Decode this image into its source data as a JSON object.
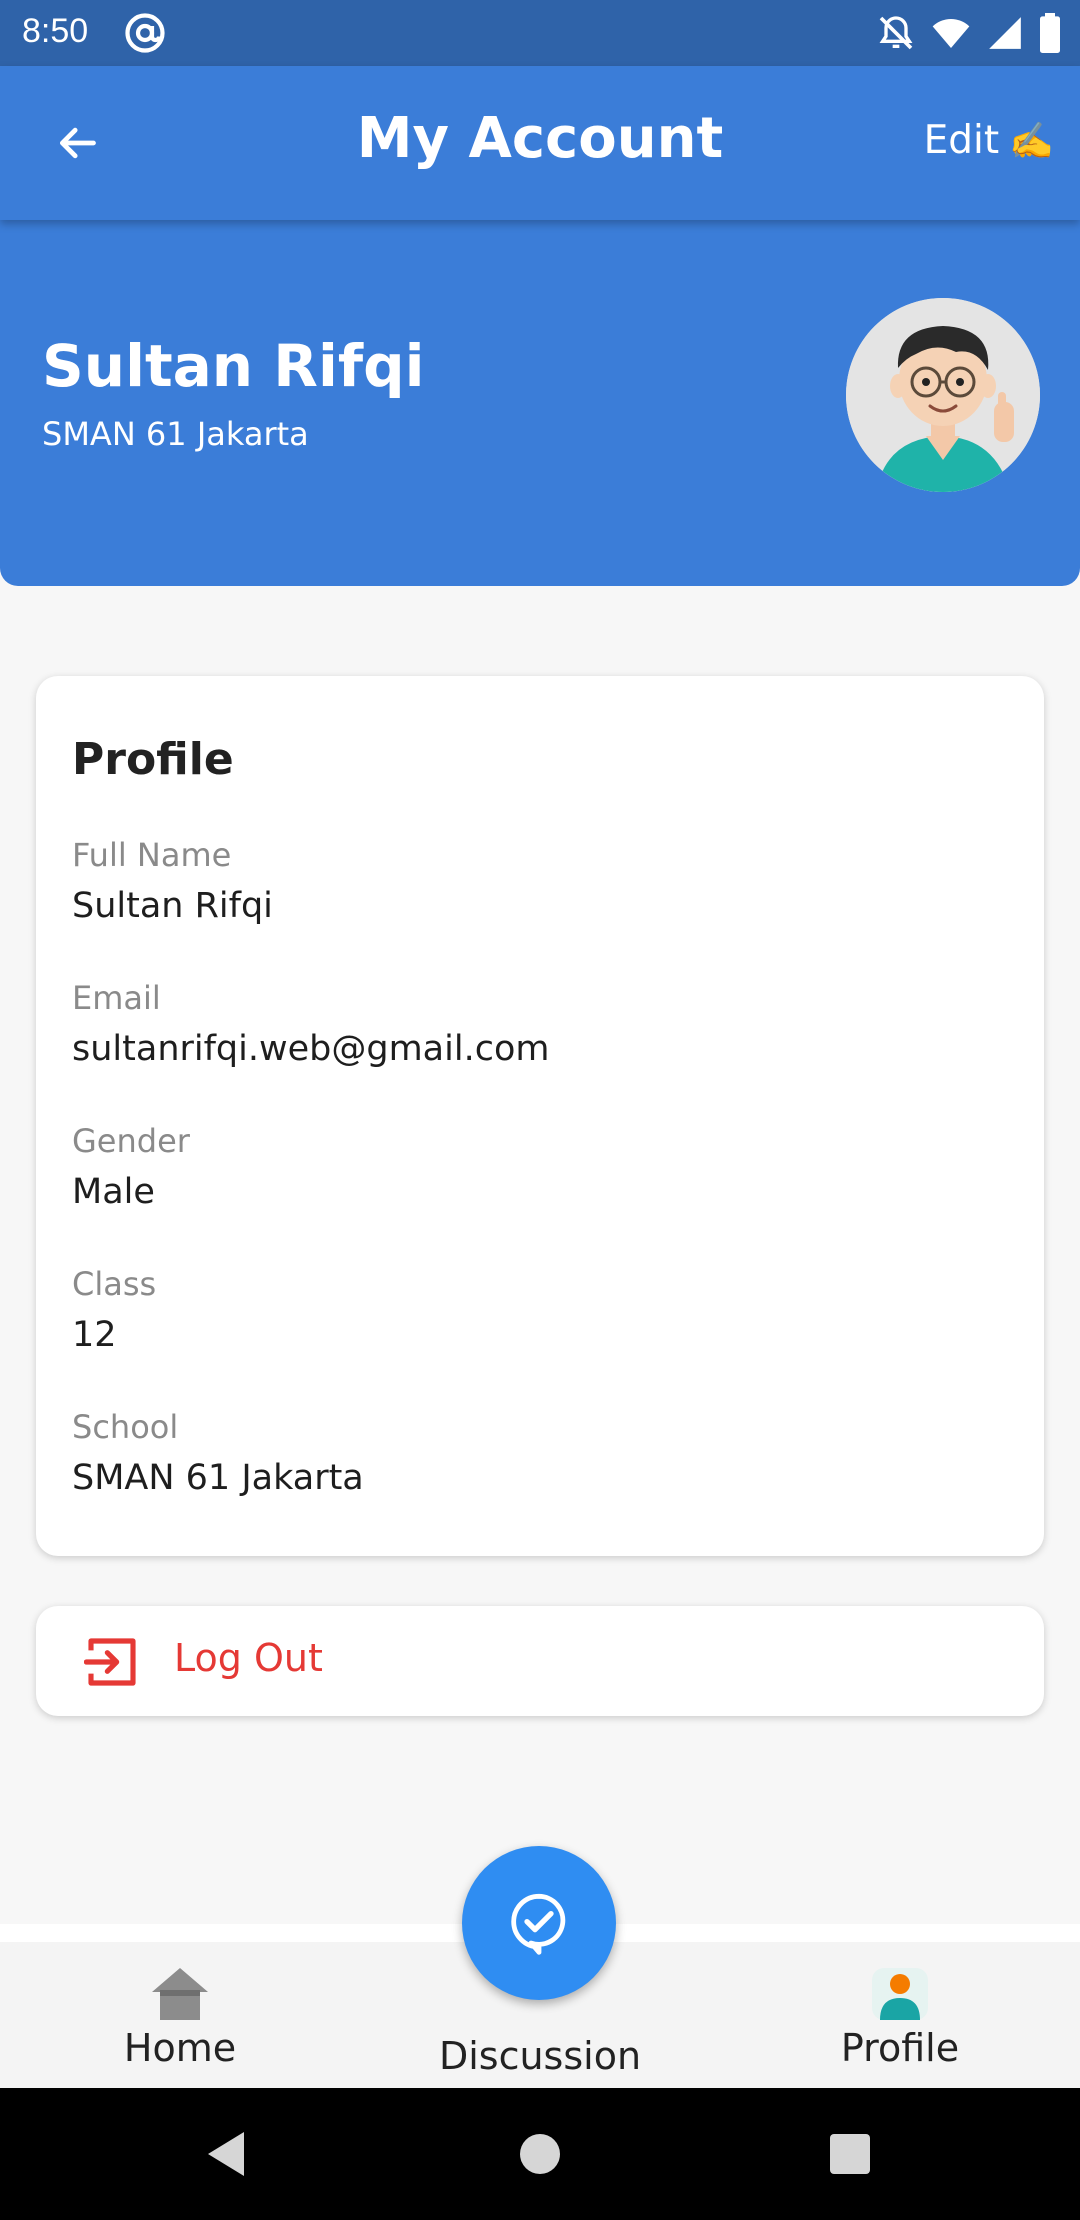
{
  "status_bar": {
    "time": "8:50"
  },
  "app_bar": {
    "title": "My Account",
    "edit_label": "Edit",
    "edit_emoji": "✍️"
  },
  "header": {
    "name": "Sultan Rifqi",
    "school": "SMAN 61 Jakarta"
  },
  "profile": {
    "title": "Profile",
    "fields": [
      {
        "label": "Full Name",
        "value": "Sultan Rifqi"
      },
      {
        "label": "Email",
        "value": "sultanrifqi.web@gmail.com"
      },
      {
        "label": "Gender",
        "value": "Male"
      },
      {
        "label": "Class",
        "value": "12"
      },
      {
        "label": "School",
        "value": "SMAN 61 Jakarta"
      }
    ]
  },
  "logout": {
    "label": "Log Out"
  },
  "bottom_nav": {
    "items": [
      {
        "label": "Home"
      },
      {
        "label": "Discussion"
      },
      {
        "label": "Profile"
      }
    ]
  },
  "colors": {
    "primary": "#3b7dd8",
    "status_bar": "#2f63a9",
    "fab": "#2f8df2",
    "danger": "#e53935",
    "profile_icon_head": "#f57c00",
    "profile_icon_body": "#1aa5a5"
  },
  "icons": [
    "back-arrow-icon",
    "at-sign-icon",
    "bell-off-icon",
    "wifi-icon",
    "signal-icon",
    "battery-icon",
    "logout-icon",
    "home-icon",
    "discussion-check-icon",
    "profile-icon",
    "nav-back-icon",
    "nav-home-icon",
    "nav-recents-icon"
  ]
}
